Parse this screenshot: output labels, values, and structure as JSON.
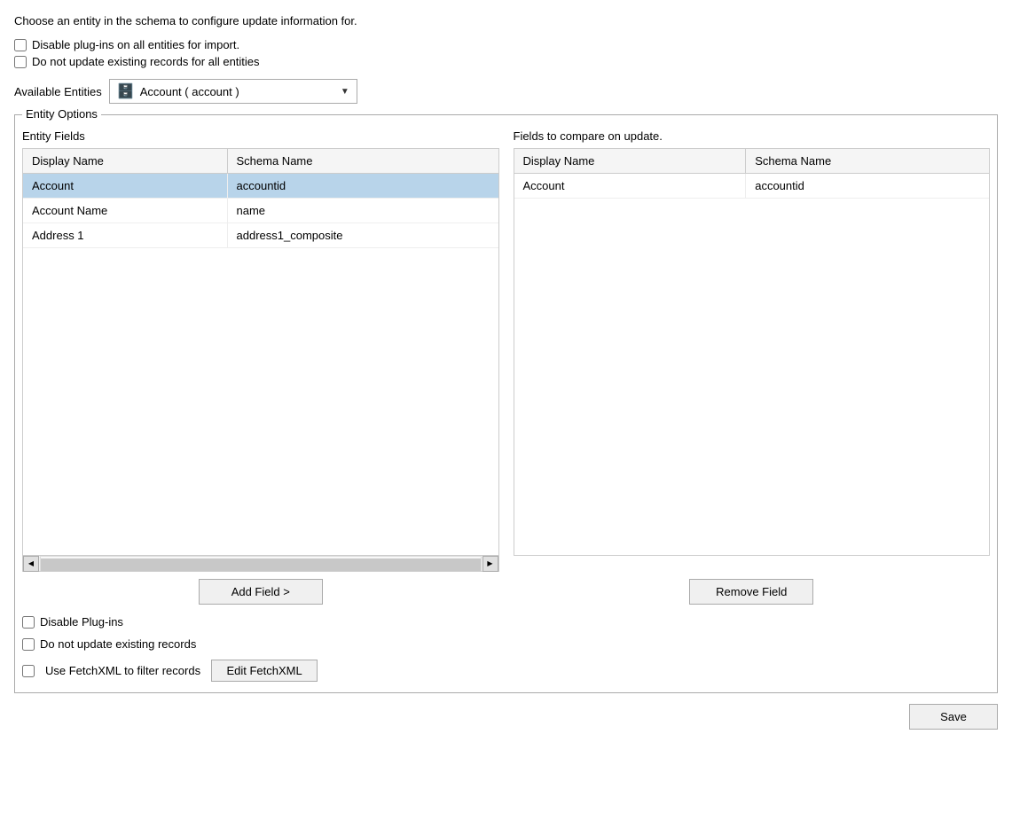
{
  "intro": {
    "text": "Choose an entity in the schema to configure update information for."
  },
  "global_checkboxes": {
    "disable_plugins_label": "Disable plug-ins on all entities for import.",
    "do_not_update_label": "Do not update existing records for all entities"
  },
  "available_entities": {
    "label": "Available Entities",
    "selected_value": "Account  (  account  )",
    "icon": "🗄️"
  },
  "entity_options": {
    "legend": "Entity Options",
    "entity_fields_title": "Entity Fields",
    "fields_to_compare_title": "Fields to compare on update.",
    "left_table": {
      "columns": [
        "Display Name",
        "Schema Name"
      ],
      "rows": [
        {
          "display_name": "Account",
          "schema_name": "accountid",
          "selected": true
        },
        {
          "display_name": "Account Name",
          "schema_name": "name",
          "selected": false
        },
        {
          "display_name": "Address 1",
          "schema_name": "address1_composite",
          "selected": false
        }
      ]
    },
    "right_table": {
      "columns": [
        "Display Name",
        "Schema Name"
      ],
      "rows": [
        {
          "display_name": "Account",
          "schema_name": "accountid"
        }
      ]
    }
  },
  "buttons": {
    "add_field": "Add Field >",
    "remove_field": "Remove Field"
  },
  "entity_checkboxes": {
    "disable_plugins_label": "Disable Plug-ins",
    "do_not_update_label": "Do not update existing records",
    "use_fetchxml_label": "Use FetchXML to filter records",
    "edit_fetchxml_label": "Edit FetchXML"
  },
  "footer": {
    "save_label": "Save"
  }
}
